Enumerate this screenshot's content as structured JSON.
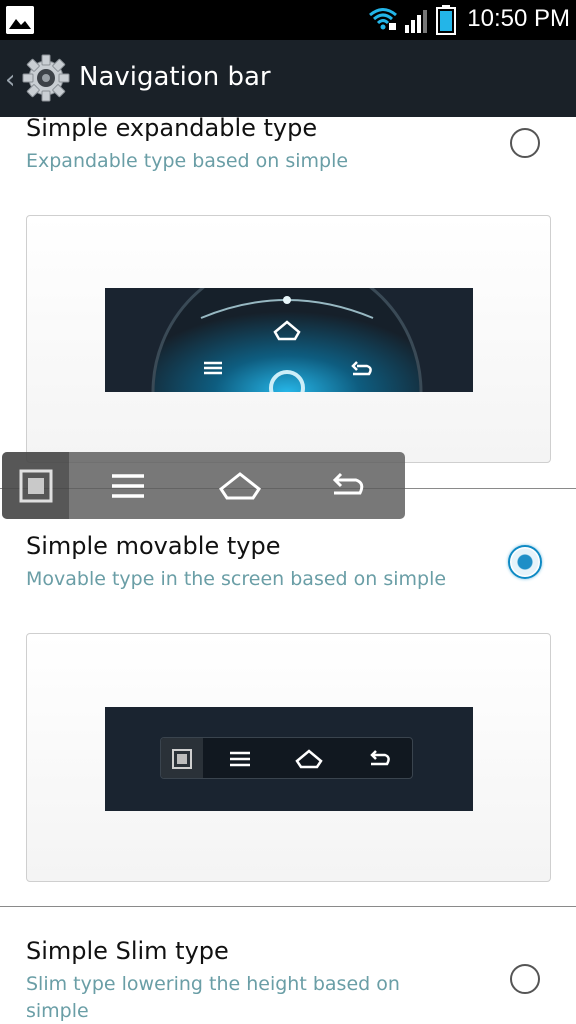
{
  "status_bar": {
    "time": "10:50 PM",
    "icons": [
      "gallery-notification-icon",
      "wifi-icon",
      "signal-icon",
      "battery-icon"
    ]
  },
  "action_bar": {
    "title": "Navigation bar",
    "icons": [
      "back-chevron-icon",
      "gear-icon"
    ]
  },
  "items": [
    {
      "title": "Simple expandable type",
      "subtitle": "Expandable type based on simple",
      "selected": false
    },
    {
      "title": "Simple movable type",
      "subtitle": "Movable type in the screen based on simple",
      "selected": true
    },
    {
      "title": "Simple Slim type",
      "subtitle": "Slim type lowering the height based on simple",
      "selected": false
    }
  ],
  "floating_nav": {
    "buttons": [
      "recent-apps-icon",
      "menu-icon",
      "home-icon",
      "back-icon"
    ]
  },
  "colors": {
    "action_bar": "#1a2128",
    "subtitle": "#6a9ea6",
    "radio_accent": "#0e8ac4",
    "preview_screen": "#1a2430"
  }
}
